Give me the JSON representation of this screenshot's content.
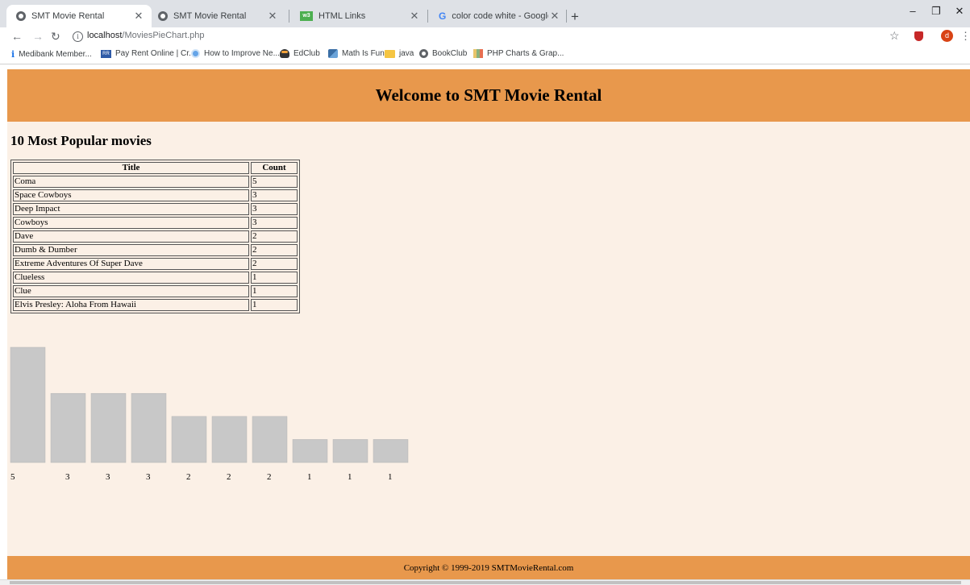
{
  "browser": {
    "tabs": [
      {
        "title": "SMT Movie Rental",
        "active": true,
        "icon": "globe-icon"
      },
      {
        "title": "SMT Movie Rental",
        "active": false,
        "icon": "globe-icon"
      },
      {
        "title": "HTML Links",
        "active": false,
        "icon": "w3schools-icon"
      },
      {
        "title": "color code white - Google Search",
        "active": false,
        "icon": "google-icon"
      }
    ],
    "url_host": "localhost",
    "url_path": "/MoviesPieChart.php",
    "avatar_letter": "d",
    "bookmarks": [
      {
        "label": "Medibank Member...",
        "icon": "info-icon"
      },
      {
        "label": "Pay Rent Online | Cr...",
        "icon": "rr-icon"
      },
      {
        "label": "How to Improve Ne...",
        "icon": "circle-icon"
      },
      {
        "label": "EdClub",
        "icon": "owl-icon"
      },
      {
        "label": "Math Is Fun",
        "icon": "math-icon"
      },
      {
        "label": "java",
        "icon": "folder-icon"
      },
      {
        "label": "BookClub",
        "icon": "globe-icon"
      },
      {
        "label": "PHP Charts & Grap...",
        "icon": "chart-icon"
      }
    ]
  },
  "page": {
    "header_title": "Welcome to SMT Movie Rental",
    "section_title": "10 Most Popular movies",
    "table": {
      "columns": [
        "Title",
        "Count"
      ],
      "rows": [
        [
          "Coma",
          "5"
        ],
        [
          "Space Cowboys",
          "3"
        ],
        [
          "Deep Impact",
          "3"
        ],
        [
          "Cowboys",
          "3"
        ],
        [
          "Dave",
          "2"
        ],
        [
          "Dumb & Dumber",
          "2"
        ],
        [
          "Extreme Adventures Of Super Dave",
          "2"
        ],
        [
          "Clueless",
          "1"
        ],
        [
          "Clue",
          "1"
        ],
        [
          "Elvis Presley: Aloha From Hawaii",
          "1"
        ]
      ]
    },
    "footer": "Copyright © 1999-2019 SMTMovieRental.com"
  },
  "chart_data": {
    "type": "bar",
    "categories": [
      "Coma",
      "Space Cowboys",
      "Deep Impact",
      "Cowboys",
      "Dave",
      "Dumb & Dumber",
      "Extreme Adventures Of Super Dave",
      "Clueless",
      "Clue",
      "Elvis Presley: Aloha From Hawaii"
    ],
    "values": [
      5,
      3,
      3,
      3,
      2,
      2,
      2,
      1,
      1,
      1
    ],
    "data_labels": [
      "5",
      "3",
      "3",
      "3",
      "2",
      "2",
      "2",
      "1",
      "1",
      "1"
    ],
    "bar_color": "#c8c8c8",
    "title": "",
    "xlabel": "",
    "ylabel": "",
    "ylim": [
      0,
      5
    ],
    "grid": false
  },
  "colors": {
    "header_bg": "#e8984c",
    "page_bg": "#fbf0e6"
  }
}
